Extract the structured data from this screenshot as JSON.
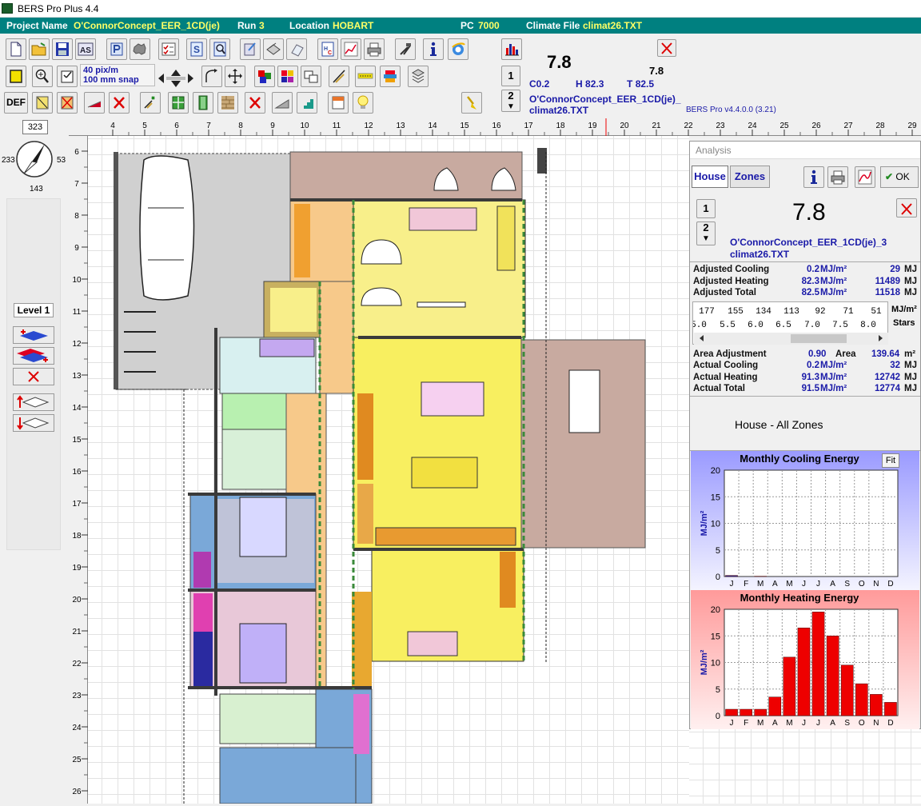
{
  "window": {
    "title": "BERS Pro Plus 4.4"
  },
  "project": {
    "name_label": "Project Name",
    "name": "O'ConnorConcept_EER_1CD(je)",
    "run_label": "Run",
    "run": "3",
    "location_label": "Location",
    "location": "HOBART",
    "pc_label": "PC",
    "pc": "7000",
    "climate_label": "Climate File",
    "climate": "climat26.TXT"
  },
  "toolbar": {
    "snap_line1": "40 pix/m",
    "snap_line2": "100 mm snap",
    "def_label": "DEF",
    "as_label": "AS"
  },
  "score_panel": {
    "rating": "7.8",
    "rating_small": "7.8",
    "c_label": "C",
    "c": "0.2",
    "h_label": "H",
    "h": "82.3",
    "t_label": "T",
    "t": "82.5",
    "run_num": "1",
    "run_num2": "2",
    "file1": "O'ConnorConcept_EER_1CD(je)_",
    "file2": "climat26.TXT",
    "version": "BERS Pro v4.4.0.0 (3.21)"
  },
  "compass": {
    "bearing": "323",
    "left": "233",
    "right": "53",
    "bottom": "143"
  },
  "level": {
    "label": "Level 1"
  },
  "ruler": {
    "top": [
      "4",
      "5",
      "6",
      "7",
      "8",
      "9",
      "10",
      "11",
      "12",
      "13",
      "14",
      "15",
      "16",
      "17",
      "18",
      "19",
      "20",
      "21",
      "22",
      "23",
      "24",
      "25",
      "26",
      "27",
      "28",
      "29"
    ],
    "left": [
      "6",
      "7",
      "8",
      "9",
      "10",
      "11",
      "12",
      "13",
      "14",
      "15",
      "16",
      "17",
      "18",
      "19",
      "20",
      "21",
      "22",
      "23",
      "24",
      "25",
      "26"
    ]
  },
  "analysis": {
    "title": "Analysis",
    "tab_house": "House",
    "tab_zones": "Zones",
    "ok_label": "OK",
    "run_num": "1",
    "run_num2": "2",
    "rating": "7.8",
    "file1": "O'ConnorConcept_EER_1CD(je)_3",
    "file2": "climat26.TXT",
    "rows": [
      {
        "label": "Adjusted Cooling",
        "v1": "0.2",
        "u1": "MJ/m²",
        "v2": "29",
        "u2": "MJ"
      },
      {
        "label": "Adjusted Heating",
        "v1": "82.3",
        "u1": "MJ/m²",
        "v2": "11489",
        "u2": "MJ"
      },
      {
        "label": "Adjusted Total",
        "v1": "82.5",
        "u1": "MJ/m²",
        "v2": "11518",
        "u2": "MJ"
      }
    ],
    "scale_top": [
      "177",
      "155",
      "134",
      "113",
      "92",
      "71",
      "51"
    ],
    "scale_top_unit": "MJ/m²",
    "scale_bottom": [
      "5.0",
      "5.5",
      "6.0",
      "6.5",
      "7.0",
      "7.5",
      "8.0"
    ],
    "scale_bottom_unit": "Stars",
    "area_label": "Area Adjustment",
    "area_adj": "0.90",
    "area_word": "Area",
    "area": "139.64",
    "area_unit": "m²",
    "actual_rows": [
      {
        "label": "Actual Cooling",
        "v1": "0.2",
        "u1": "MJ/m²",
        "v2": "32",
        "u2": "MJ"
      },
      {
        "label": "Actual Heating",
        "v1": "91.3",
        "u1": "MJ/m²",
        "v2": "12742",
        "u2": "MJ"
      },
      {
        "label": "Actual Total",
        "v1": "91.5",
        "u1": "MJ/m²",
        "v2": "12774",
        "u2": "MJ"
      }
    ],
    "zone_caption": "House - All Zones",
    "fit_label": "Fit"
  },
  "chart_data": [
    {
      "type": "bar",
      "title": "Monthly Cooling Energy",
      "ylabel": "MJ/m²",
      "categories": [
        "J",
        "F",
        "M",
        "A",
        "M",
        "J",
        "J",
        "A",
        "S",
        "O",
        "N",
        "D"
      ],
      "values": [
        0.2,
        0,
        0.05,
        0,
        0,
        0,
        0,
        0,
        0,
        0,
        0,
        0
      ],
      "ylim": [
        0,
        20
      ],
      "yticks": [
        "0",
        "5",
        "10",
        "15",
        "20"
      ],
      "color": "#2828a0",
      "bg_top": "#9a9aff"
    },
    {
      "type": "bar",
      "title": "Monthly Heating Energy",
      "ylabel": "MJ/m²",
      "categories": [
        "J",
        "F",
        "M",
        "A",
        "M",
        "J",
        "J",
        "A",
        "S",
        "O",
        "N",
        "D"
      ],
      "values": [
        1.2,
        1.2,
        1.2,
        3.5,
        11,
        16.5,
        19.5,
        15,
        9.5,
        6,
        4,
        2.5
      ],
      "ylim": [
        0,
        20
      ],
      "yticks": [
        "0",
        "5",
        "10",
        "15",
        "20"
      ],
      "color": "#ee0000",
      "bg_top": "#ff9a9a"
    }
  ]
}
